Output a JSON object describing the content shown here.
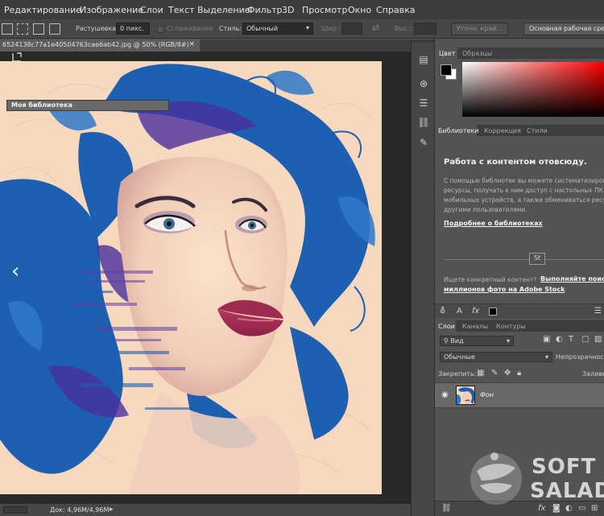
{
  "menu": [
    "Редактирование",
    "Изображение",
    "Слои",
    "Текст",
    "Выделение",
    "Фильтр",
    "3D",
    "Просмотр",
    "Окно",
    "Справка"
  ],
  "options": {
    "feather_label": "Растушевка:",
    "feather_value": "0 пикс.",
    "antialias_label": "Сглаживание",
    "style_label": "Стиль:",
    "style_value": "Обычный",
    "width_label": "Шир.:",
    "height_label": "Выс.:",
    "refine_edge": "Уточн. край...",
    "workspace": "Основная рабочая среда"
  },
  "document": {
    "tab": "6524138c77a1e40504763cae6ab42.jpg @ 50% (RGB/8#)",
    "close": "×",
    "status": "Док: 4,96M/4,96M",
    "nav_prev": "‹",
    "nav_next": "›"
  },
  "color_panel": {
    "tabs": [
      "Цвет",
      "Образцы"
    ],
    "active_tab": 0,
    "foreground": "#000000",
    "background": "#ffffff",
    "spectrum_hue": "#ff0000"
  },
  "libraries_panel": {
    "tabs": [
      "Библиотеки",
      "Коррекция",
      "Стили"
    ],
    "active_tab": 0,
    "library_name": "Моя библиотека",
    "title": "Работа с контентом отовсюду.",
    "description": [
      "С помощью библиотек вы можете систематизирова",
      "ресурсы, получать к ним доступ с настольных ПК",
      "мобильных устройств, а также обмениваться ресу",
      "другими пользователями."
    ],
    "learn_more": "Подробнее о библиотеках",
    "stock_badge": "St",
    "stock_prompt": "Ищете конкретный контент?",
    "stock_link_1": "Выполняйте поис",
    "stock_link_2": "миллионов фото на Adobe Stock",
    "toolbar_letter": "A",
    "toolbar_fx": "fx"
  },
  "layers_panel": {
    "tabs": [
      "Слои",
      "Каналы",
      "Контуры"
    ],
    "active_tab": 0,
    "filter_label": "Вид",
    "blend_mode": "Обычные",
    "opacity_label": "Непрозрачность",
    "lock_label": "Закрепить:",
    "fill_label": "Заливка",
    "layers": [
      {
        "name": "Фон",
        "visible": true
      }
    ],
    "footer_fx": "fx"
  },
  "watermark": {
    "line1": "SOFT",
    "line2": "SALAD"
  },
  "colors": {
    "menubar": "#3c3c3c",
    "panel": "#535353",
    "canvas_bg": "#282828",
    "ink_blue": "#1d5fb0",
    "ink_purple": "#4a2f9e",
    "skin": "#f6d8bf"
  }
}
